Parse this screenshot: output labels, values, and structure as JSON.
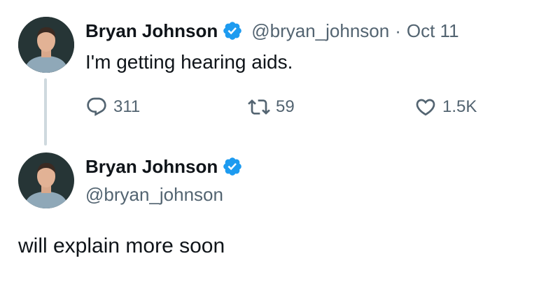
{
  "colors": {
    "text_primary": "#0f1419",
    "text_secondary": "#536471",
    "verified_blue": "#1d9bf0",
    "thread_line": "#cfd9de"
  },
  "tweet1": {
    "author": {
      "display_name": "Bryan Johnson",
      "handle": "@bryan_johnson",
      "verified_icon": "verified-badge-icon",
      "avatar_icon": "avatar-photo"
    },
    "separator": "·",
    "date": "Oct 11",
    "text": "I'm getting hearing aids.",
    "actions": {
      "replies": "311",
      "reposts": "59",
      "likes": "1.5K"
    }
  },
  "tweet2": {
    "author": {
      "display_name": "Bryan Johnson",
      "handle": "@bryan_johnson",
      "verified_icon": "verified-badge-icon",
      "avatar_icon": "avatar-photo"
    },
    "text": "will explain more soon"
  }
}
